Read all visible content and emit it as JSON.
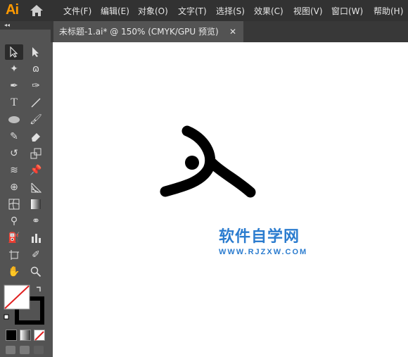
{
  "app": {
    "logo": "Ai"
  },
  "menu": [
    "文件(F)",
    "编辑(E)",
    "对象(O)",
    "文字(T)",
    "选择(S)",
    "效果(C)",
    "视图(V)",
    "窗口(W)",
    "帮助(H)"
  ],
  "panel": {
    "collapse_glyph": "◂◂"
  },
  "document_tab": {
    "title": "未标题-1.ai* @ 150% (CMYK/GPU 预览)",
    "close": "✕"
  },
  "watermark": {
    "name": "软件自学网",
    "url": "WWW.RJZXW.COM"
  },
  "colors": {
    "accent": "#2b7ccf",
    "logo": "#ff9a00",
    "menubar": "#323232",
    "panel": "#535353",
    "canvas": "#ffffff",
    "stroke": "#000000"
  },
  "tools": [
    "selection-tool",
    "direct-selection-tool",
    "magic-wand-tool",
    "lasso-tool",
    "pen-tool",
    "curvature-tool",
    "type-tool",
    "line-segment-tool",
    "ellipse-tool",
    "paintbrush-tool",
    "pencil-tool",
    "eraser-tool",
    "rotate-tool",
    "scale-tool",
    "width-tool",
    "puppet-warp-tool",
    "shape-builder-tool",
    "perspective-grid-tool",
    "mesh-tool",
    "gradient-tool",
    "eyedropper-tool",
    "blend-tool",
    "symbol-sprayer-tool",
    "column-graph-tool",
    "artboard-tool",
    "slice-tool",
    "hand-tool",
    "zoom-tool"
  ]
}
